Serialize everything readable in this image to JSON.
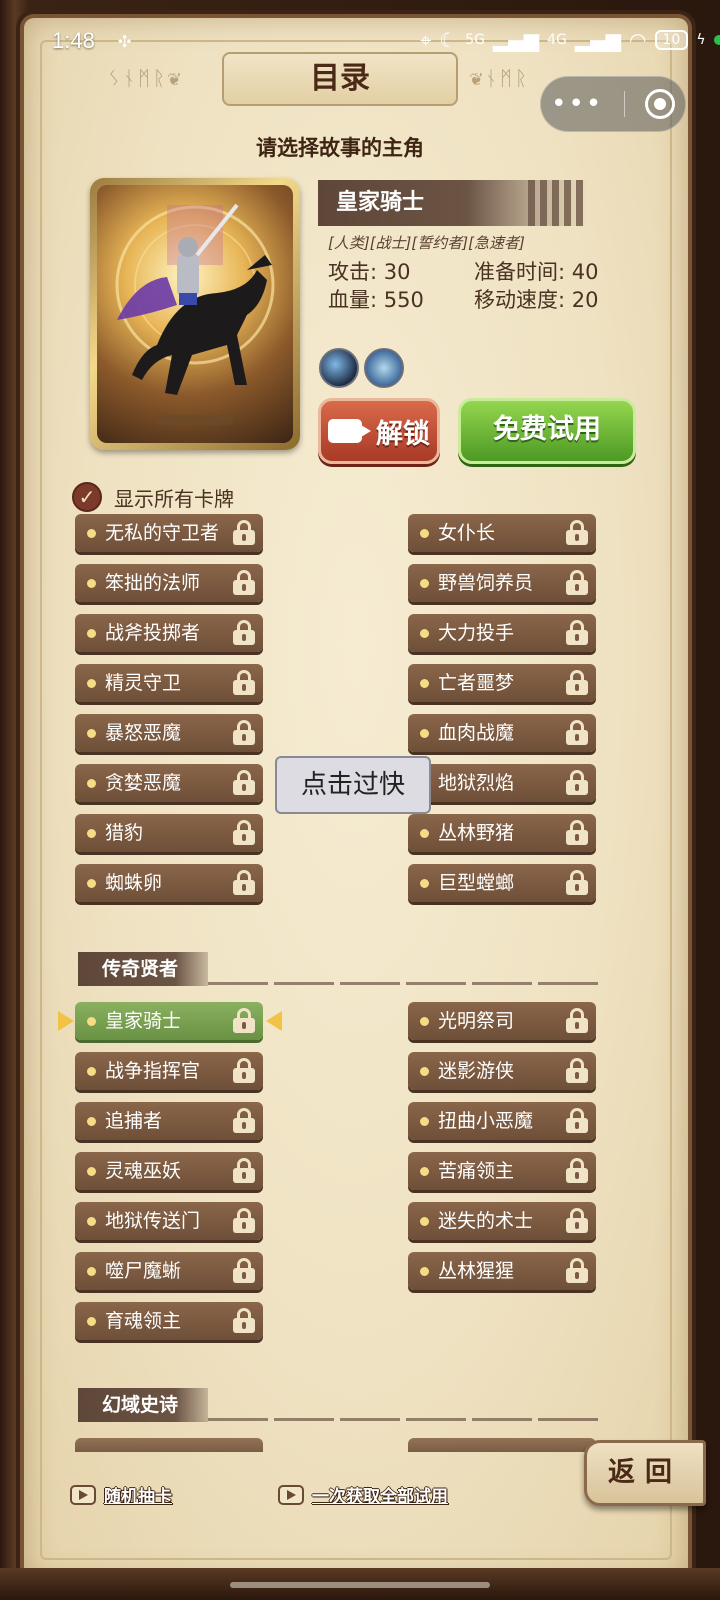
{
  "status_bar": {
    "time": "1:48",
    "signal_5g": "5G",
    "signal_4g": "4G",
    "battery": "10"
  },
  "header": {
    "title": "目录",
    "subtitle": "请选择故事的主角"
  },
  "hero": {
    "name": "皇家骑士",
    "tags": "[人类][战士][誓约者][急速者]",
    "attack_label": "攻击: 30",
    "hp_label": "血量: 550",
    "prep_label": "准备时间: 40",
    "speed_label": "移动速度: 20"
  },
  "buttons": {
    "unlock": "解锁",
    "free_trial": "免费试用",
    "random_draw": "随机抽卡",
    "get_all_trial": "一次获取全部试用",
    "back": "返回"
  },
  "show_all": {
    "label": "显示所有卡牌",
    "checked": true
  },
  "toast": "点击过快",
  "group1": {
    "left": [
      "无私的守卫者",
      "笨拙的法师",
      "战斧投掷者",
      "精灵守卫",
      "暴怒恶魔",
      "贪婪恶魔",
      "猎豹",
      "蜘蛛卵"
    ],
    "right": [
      "女仆长",
      "野兽饲养员",
      "大力投手",
      "亡者噩梦",
      "血肉战魔",
      "地狱烈焰",
      "丛林野猪",
      "巨型螳螂"
    ]
  },
  "group2": {
    "title": "传奇贤者",
    "left": [
      "皇家骑士",
      "战争指挥官",
      "追捕者",
      "灵魂巫妖",
      "地狱传送门",
      "噬尸魔蜥",
      "育魂领主"
    ],
    "right": [
      "光明祭司",
      "迷影游侠",
      "扭曲小恶魔",
      "苦痛领主",
      "迷失的术士",
      "丛林猩猩"
    ],
    "selected": "皇家骑士"
  },
  "group3": {
    "title": "幻域史诗"
  },
  "colors": {
    "paper": "#efe2c2",
    "item_bg": "#7a5a40",
    "selected_bg": "#7aa052",
    "unlock_btn": "#c04f35",
    "trial_btn": "#6fb83a"
  }
}
